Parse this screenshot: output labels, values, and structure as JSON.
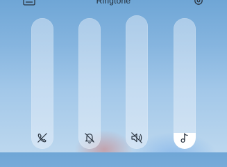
{
  "panel": {
    "title": "Ringtone"
  },
  "top_icons": {
    "left": "subtitles-icon",
    "right": "settings-gear-icon"
  },
  "sliders": [
    {
      "id": "call",
      "icon": "phone-muted-icon",
      "level": 0
    },
    {
      "id": "notification",
      "icon": "bell-muted-icon",
      "level": 0
    },
    {
      "id": "media",
      "icon": "speaker-muted-icon",
      "level": 0
    },
    {
      "id": "ringtone",
      "icon": "music-note-icon",
      "level": 0.125
    }
  ],
  "colors": {
    "icon_dark": "#2a3440",
    "fill_active": "#ffffff"
  }
}
